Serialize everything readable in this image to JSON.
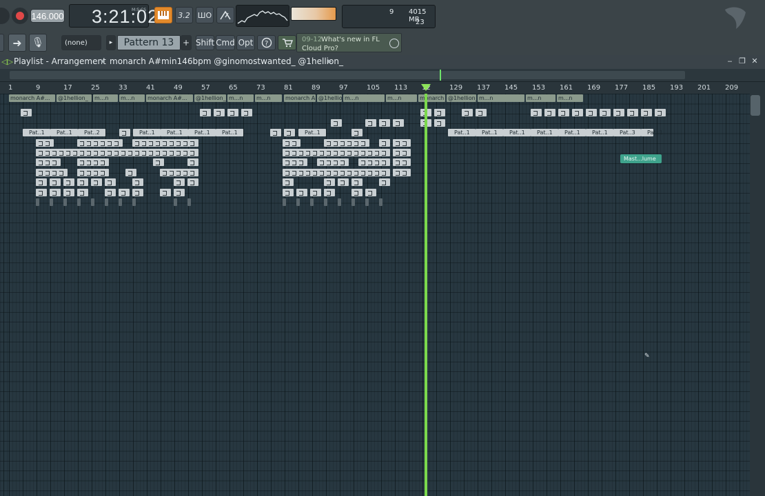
{
  "toolbar": {
    "tempo": "146.000",
    "time": "3:21:02",
    "time_unit": "M:S:CS",
    "mode_32": "3.2",
    "mode_wo": "ШO",
    "cpu": "9",
    "memory": "4015 MB",
    "polyphony": "23",
    "arrow_glyph": "➜",
    "mic_glyph": "🎙",
    "none_select": "(none)",
    "pattern_prev": "▸",
    "pattern": "Pattern 13",
    "pattern_add": "+",
    "shift_label": "Shift",
    "cmd_label": "Cmd",
    "opt_label": "Opt",
    "news_date": "09-12",
    "news_line1": "What's new in FL",
    "news_line2": "Cloud Pro?",
    "accent_color": "#e38a2b"
  },
  "playlist": {
    "title": "Playlist - Arrangement",
    "separator": "▸",
    "song": "monarch A#min146bpm @ginomostwanted_ @1hellion_",
    "song_arrow": "▸",
    "ruler_ticks": [
      "1",
      "9",
      "17",
      "25",
      "33",
      "41",
      "49",
      "57",
      "65",
      "73",
      "81",
      "89",
      "97",
      "105",
      "113",
      "12",
      "129",
      "137",
      "145",
      "153",
      "161",
      "169",
      "177",
      "185",
      "193",
      "201",
      "209"
    ],
    "marker_labels": [
      "monarch A#...",
      "@1hellion_",
      "m...n",
      "m...n",
      "monarch A#...",
      "@1hellion_",
      "m...n",
      "m...n",
      "monarch A#...",
      "@1hellion_",
      "m...n",
      "m...n",
      "monarch A#...",
      "@1hellion_",
      "m...n",
      "m...n",
      "m...n"
    ],
    "pattern_labels": [
      "Pat..1",
      "Pat..1",
      "Pat..2",
      "Pat..1",
      "Pat..1",
      "Pat..1",
      "Pat..1",
      "Pat..1",
      "Pat..1",
      "Pat..1",
      "Pat..1",
      "Pat..1",
      "Pat..1",
      "Pat..1",
      "Pat..3",
      "Pat..1"
    ],
    "automation_clip": "Mast...lume",
    "playhead_color": "#7bd94c"
  },
  "icons": {
    "pl_icon": "◁▷",
    "minimize": "‒",
    "restore": "❐",
    "close": "✕",
    "cursor": "✎"
  }
}
